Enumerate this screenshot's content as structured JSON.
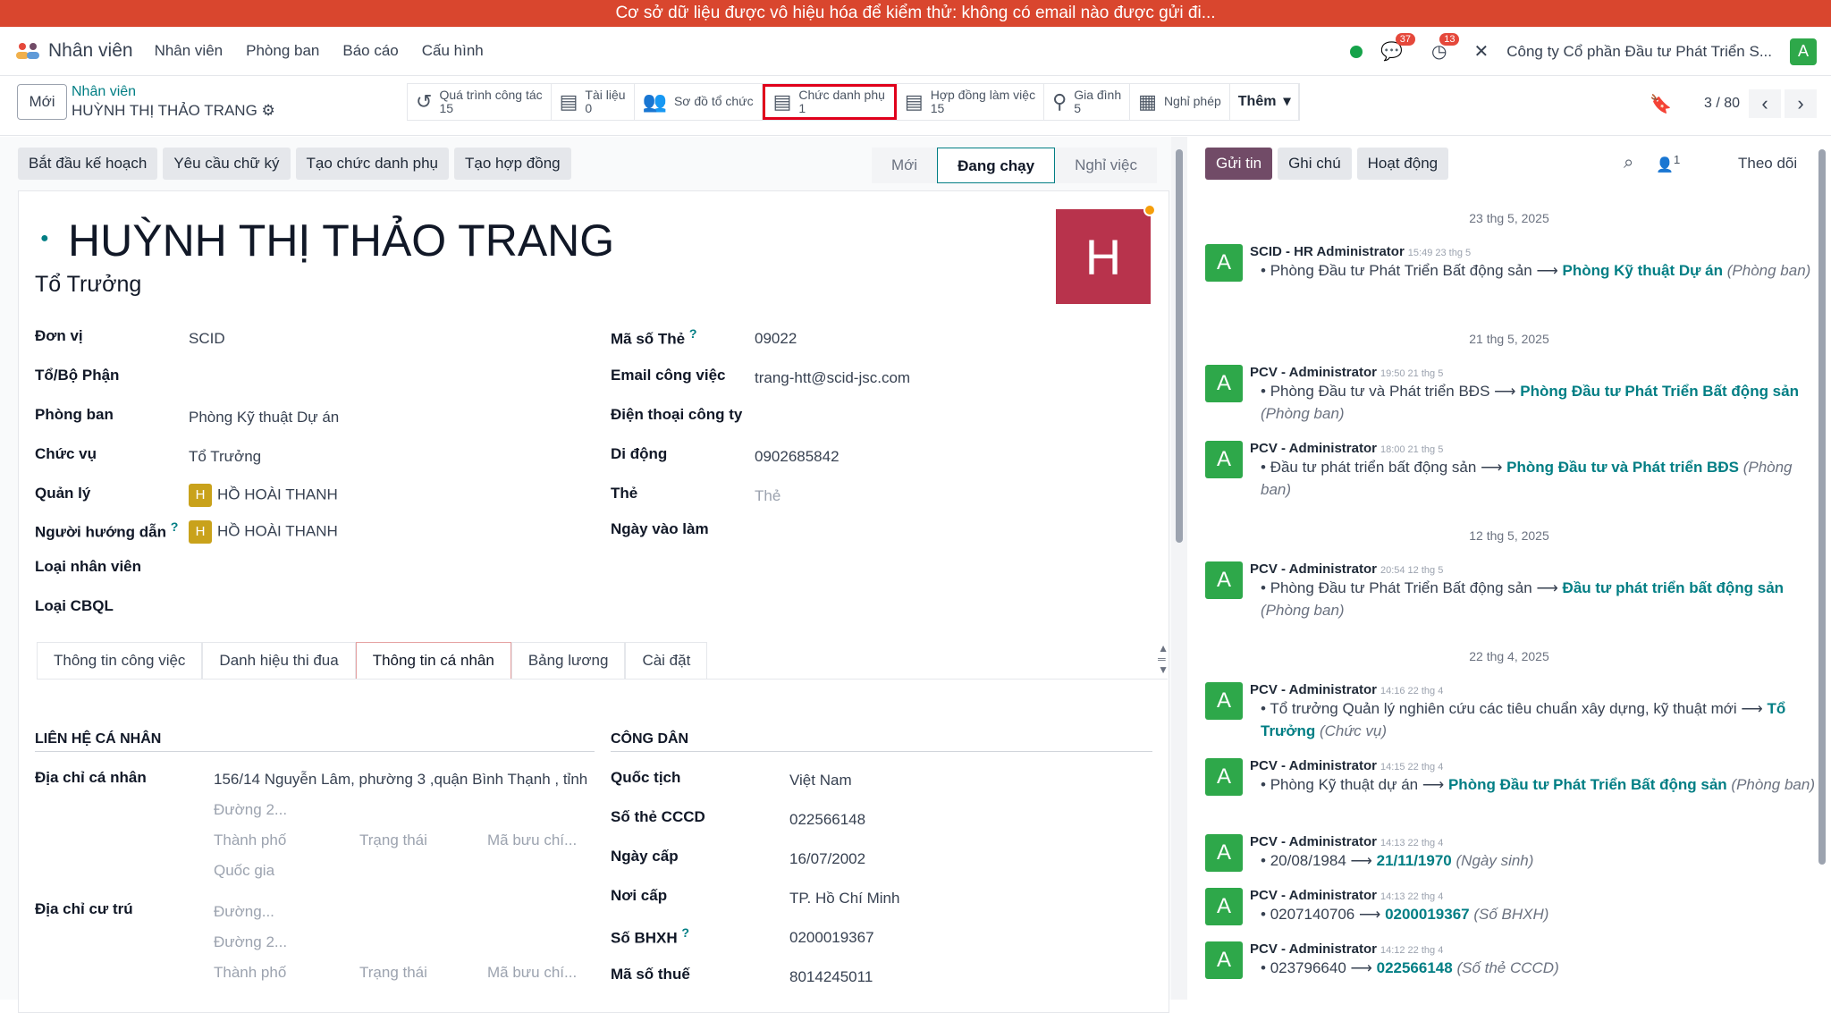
{
  "banner": "Cơ sở dữ liệu được vô hiệu hóa để kiểm thử: không có email nào được gửi đi...",
  "navbar": {
    "app": "Nhân viên",
    "menu": [
      "Nhân viên",
      "Phòng ban",
      "Báo cáo",
      "Cấu hình"
    ],
    "chat_count": "37",
    "activity_count": "13",
    "company": "Công ty Cổ phần Đầu tư Phát Triển S...",
    "user_initial": "A"
  },
  "control": {
    "new": "Mới",
    "breadcrumb_parent": "Nhân viên",
    "breadcrumb_current": "HUỲNH THỊ THẢO TRANG",
    "smart": [
      {
        "label": "Quá trình công tác",
        "count": "15"
      },
      {
        "label": "Tài liệu",
        "count": "0"
      },
      {
        "label": "Sơ đồ tổ chức",
        "count": ""
      },
      {
        "label": "Chức danh phụ",
        "count": "1"
      },
      {
        "label": "Hợp đồng làm việc",
        "count": "15"
      },
      {
        "label": "Gia đình",
        "count": "5"
      },
      {
        "label": "Nghỉ phép",
        "count": ""
      }
    ],
    "more": "Thêm",
    "pager": "3 / 80"
  },
  "actions": [
    "Bắt đầu kế hoạch",
    "Yêu cầu chữ ký",
    "Tạo chức danh phụ",
    "Tạo hợp đồng"
  ],
  "statusbar": [
    "Mới",
    "Đang chạy",
    "Nghỉ việc"
  ],
  "employee": {
    "name": "HUỲNH THỊ THẢO TRANG",
    "job_title": "Tổ Trưởng",
    "photo_initial": "H"
  },
  "fields_left": [
    {
      "label": "Đơn vị",
      "value": "SCID"
    },
    {
      "label": "Tổ/Bộ Phận",
      "value": ""
    },
    {
      "label": "Phòng ban",
      "value": "Phòng Kỹ thuật Dự án"
    },
    {
      "label": "Chức vụ",
      "value": "Tổ Trưởng"
    },
    {
      "label": "Quản lý",
      "value": "HỒ HOÀI THANH"
    },
    {
      "label": "Người hướng dẫn",
      "value": "HỒ HOÀI THANH"
    },
    {
      "label": "Loại nhân viên",
      "value": ""
    },
    {
      "label": "Loại CBQL",
      "value": ""
    }
  ],
  "fields_right": [
    {
      "label": "Mã số Thẻ",
      "value": "09022"
    },
    {
      "label": "Email công việc",
      "value": "trang-htt@scid-jsc.com"
    },
    {
      "label": "Điện thoại công ty",
      "value": ""
    },
    {
      "label": "Di động",
      "value": "0902685842"
    },
    {
      "label": "Thẻ",
      "value": "Thẻ"
    },
    {
      "label": "Ngày vào làm",
      "value": ""
    }
  ],
  "tabs": [
    "Thông tin công việc",
    "Danh hiệu thi đua",
    "Thông tin cá nhân",
    "Bảng lương",
    "Cài đặt"
  ],
  "personal": {
    "section_left": "LIÊN HỆ CÁ NHÂN",
    "section_right": "CÔNG DÂN",
    "addr_label": "Địa chỉ cá nhân",
    "addr_value": "156/14 Nguyễn Lâm, phường 3 ,quận Bình Thạnh , tỉnh",
    "street2": "Đường 2...",
    "city": "Thành phố",
    "state": "Trạng thái",
    "zip": "Mã bưu chí...",
    "country": "Quốc gia",
    "res_label": "Địa chỉ cư trú",
    "street": "Đường...",
    "citizen": [
      {
        "label": "Quốc tịch",
        "value": "Việt Nam"
      },
      {
        "label": "Số thẻ CCCD",
        "value": "022566148"
      },
      {
        "label": "Ngày cấp",
        "value": "16/07/2002"
      },
      {
        "label": "Nơi cấp",
        "value": "TP. Hồ Chí Minh"
      },
      {
        "label": "Số BHXH",
        "value": "0200019367"
      },
      {
        "label": "Mã số thuế",
        "value": "8014245011"
      }
    ]
  },
  "chatter": {
    "send": "Gửi tin",
    "note": "Ghi chú",
    "activity": "Hoạt động",
    "followers": "1",
    "follow": "Theo dõi",
    "dates": [
      "23 thg 5, 2025",
      "21 thg 5, 2025",
      "12 thg 5, 2025",
      "22 thg 4, 2025"
    ],
    "messages": [
      {
        "author": "SCID - HR Administrator",
        "time": "15:49 23 thg 5",
        "old": "Phòng Đầu tư Phát Triển Bất động sản",
        "new": "Phòng Kỹ thuật Dự án",
        "field": "(Phòng ban)"
      },
      {
        "author": "PCV - Administrator",
        "time": "19:50 21 thg 5",
        "old": "Phòng Đầu tư và Phát triển BĐS",
        "new": "Phòng Đầu tư Phát Triển Bất động sản",
        "field": "(Phòng ban)"
      },
      {
        "author": "PCV - Administrator",
        "time": "18:00 21 thg 5",
        "old": "Đầu tư phát triển bất động sản",
        "new": "Phòng Đầu tư và Phát triển BĐS",
        "field": "(Phòng ban)"
      },
      {
        "author": "PCV - Administrator",
        "time": "20:54 12 thg 5",
        "old": "Phòng Đầu tư Phát Triển Bất động sản",
        "new": "Đầu tư phát triển bất động sản",
        "field": "(Phòng ban)"
      },
      {
        "author": "PCV - Administrator",
        "time": "14:16 22 thg 4",
        "old": "Tổ trưởng Quản lý nghiên cứu các tiêu chuẩn xây dựng, kỹ thuật mới",
        "new": "Tổ Trưởng",
        "field": "(Chức vụ)"
      },
      {
        "author": "PCV - Administrator",
        "time": "14:15 22 thg 4",
        "old": "Phòng Kỹ thuật dự án",
        "new": "Phòng Đầu tư Phát Triển Bất động sản",
        "field": "(Phòng ban)"
      },
      {
        "author": "PCV - Administrator",
        "time": "14:13 22 thg 4",
        "old": "20/08/1984",
        "new": "21/11/1970",
        "field": "(Ngày sinh)"
      },
      {
        "author": "PCV - Administrator",
        "time": "14:13 22 thg 4",
        "old": "0207140706",
        "new": "0200019367",
        "field": "(Số BHXH)"
      },
      {
        "author": "PCV - Administrator",
        "time": "14:12 22 thg 4",
        "old": "023796640",
        "new": "022566148",
        "field": "(Số thẻ CCCD)"
      }
    ]
  },
  "colors": {
    "banner": "#d9462e",
    "accent": "#017e84",
    "primary": "#714b67",
    "highlight": "#e0001b"
  }
}
